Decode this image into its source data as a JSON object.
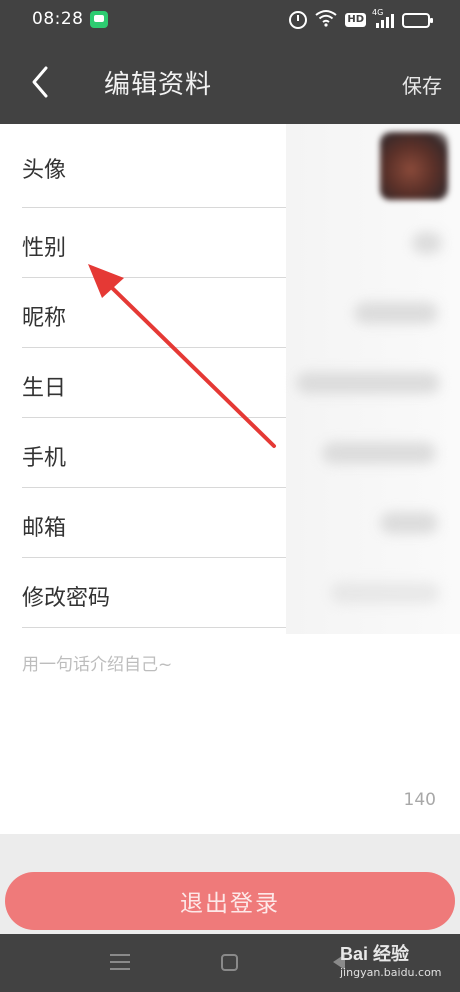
{
  "status_bar": {
    "time": "08:28",
    "hd": "HD",
    "network": "4G"
  },
  "header": {
    "title": "编辑资料",
    "save_label": "保存"
  },
  "profile_rows": [
    {
      "label": "头像"
    },
    {
      "label": "性别"
    },
    {
      "label": "昵称"
    },
    {
      "label": "生日"
    },
    {
      "label": "手机"
    },
    {
      "label": "邮箱"
    },
    {
      "label": "修改密码"
    }
  ],
  "intro": {
    "placeholder": "用一句话介绍自己~",
    "char_count": "140"
  },
  "logout_label": "退出登录",
  "watermark": {
    "logo": "Bai 经验",
    "url": "jingyan.baidu.com"
  },
  "colors": {
    "bar": "#424242",
    "accent": "#ef7a7a",
    "arrow": "#e53935"
  }
}
